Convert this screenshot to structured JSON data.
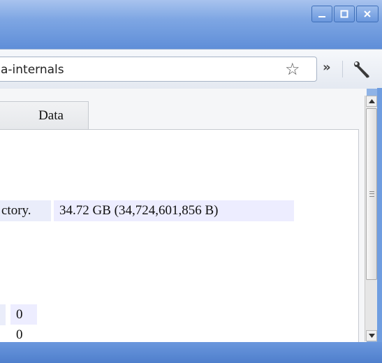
{
  "window": {
    "controls": [
      "minimize",
      "maximize",
      "close"
    ]
  },
  "toolbar": {
    "url": "a-internals",
    "star_icon": "star-icon",
    "more_icon": "chevron-double-right-icon",
    "wrench_icon": "wrench-icon"
  },
  "tabs": [
    {
      "label": "Data"
    }
  ],
  "content": {
    "row1_label_fragment": "ctory.",
    "row1_value": "34.72 GB (34,724,601,856 B)",
    "values": [
      "0",
      "0"
    ]
  },
  "colors": {
    "cell_bg": "#eaedfa",
    "frame_blue": "#6a97dd"
  }
}
